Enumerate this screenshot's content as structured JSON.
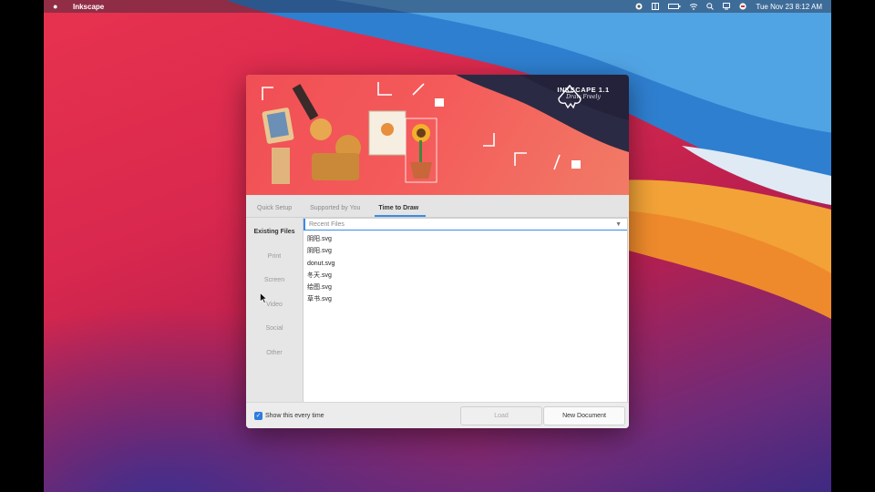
{
  "menubar": {
    "app_name": "Inkscape",
    "clock": "Tue Nov 23  8:12 AM",
    "icons": [
      "apple-icon",
      "record-icon",
      "grid-icon",
      "battery-icon",
      "wifi-icon",
      "search-icon",
      "display-icon",
      "user-flag-icon"
    ]
  },
  "dialog": {
    "brand": {
      "name": "INKSCAPE 1.1",
      "tagline": "Draw Freely"
    },
    "tabs": [
      {
        "label": "Quick Setup"
      },
      {
        "label": "Supported by You"
      },
      {
        "label": "Time to Draw"
      }
    ],
    "active_tab": "Time to Draw",
    "sidebar": [
      {
        "label": "Existing Files"
      },
      {
        "label": "Print"
      },
      {
        "label": "Screen"
      },
      {
        "label": "Video"
      },
      {
        "label": "Social"
      },
      {
        "label": "Other"
      }
    ],
    "recent": {
      "header": "Recent Files",
      "files": [
        "阴阳.svg",
        "阴阳.svg",
        "donut.svg",
        "冬天.svg",
        "绘图.svg",
        "草书.svg"
      ]
    },
    "footer": {
      "checkbox_label": "Show this every time",
      "checkbox_checked": true,
      "load_label": "Load",
      "new_document_label": "New Document"
    }
  },
  "colors": {
    "accent": "#3a8be6",
    "banner": "#f04f55",
    "dark_banner": "#2b2a45"
  }
}
